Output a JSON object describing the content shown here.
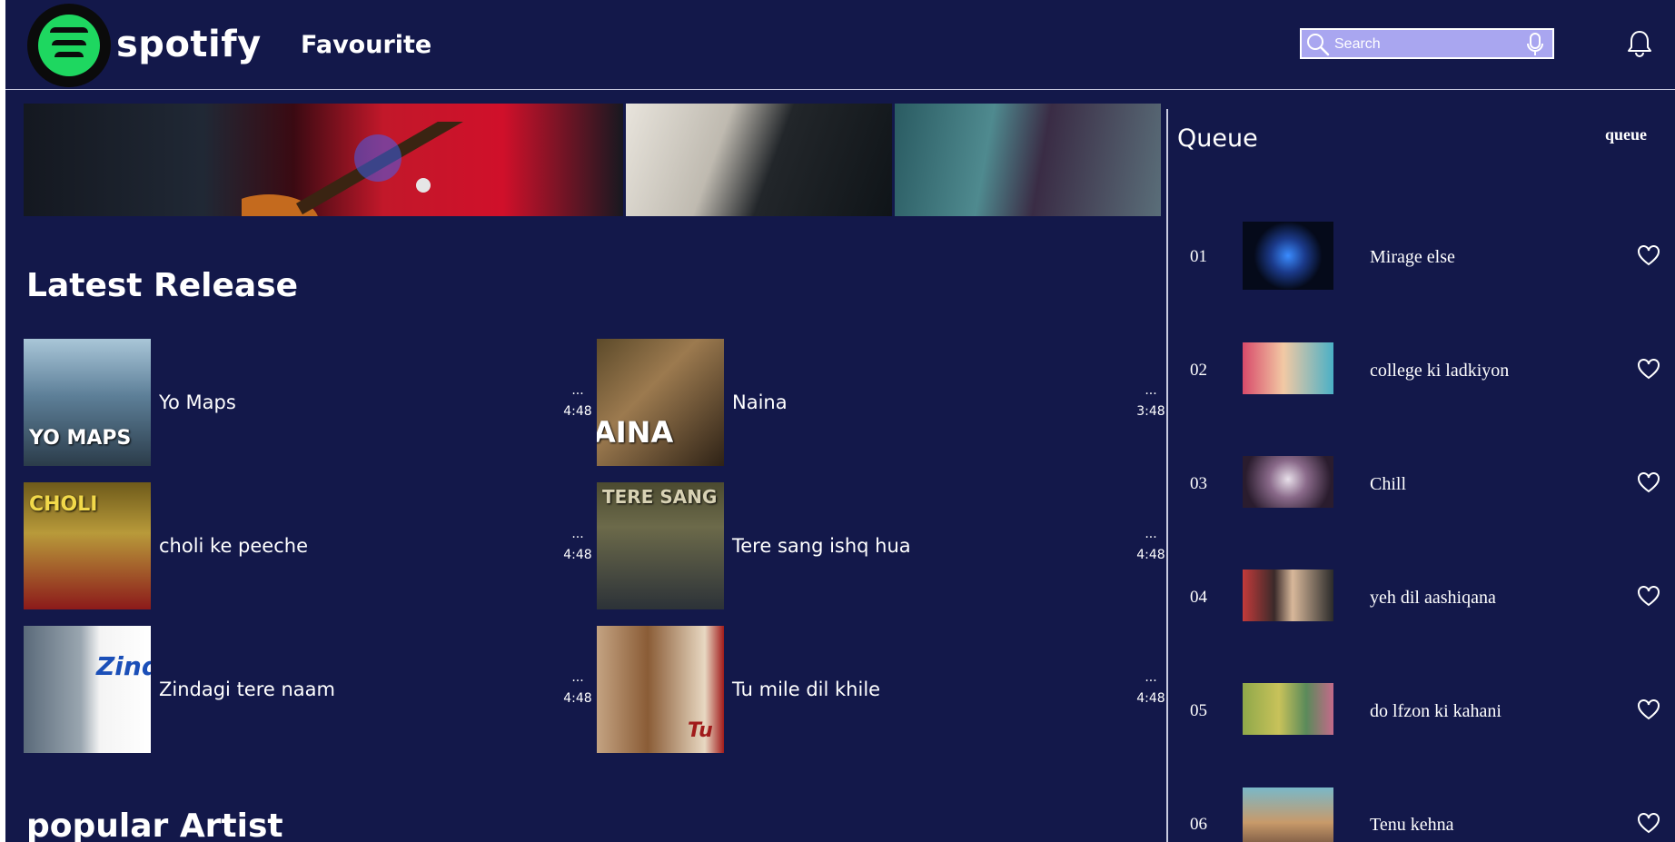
{
  "header": {
    "brand": "spotify",
    "nav_favourite": "Favourite",
    "search_placeholder": "Search"
  },
  "icons": {
    "logo": "spotify-logo",
    "search": "search-icon",
    "mic": "mic-icon",
    "bell": "bell-icon",
    "heart": "heart-icon"
  },
  "colors": {
    "background": "#13184a",
    "search_box": "#a9a6f0",
    "brand_green": "#1ed760"
  },
  "latest_release": {
    "title": "Latest Release",
    "songs": [
      {
        "title": "Yo Maps",
        "more": "...",
        "duration": "4:48",
        "cover_text": "YO MAPS"
      },
      {
        "title": "Naina",
        "more": "...",
        "duration": "3:48",
        "cover_text": "AINA"
      },
      {
        "title": "choli ke peeche",
        "more": "...",
        "duration": "4:48",
        "cover_text": "CHOLI"
      },
      {
        "title": "Tere sang ishq hua",
        "more": "...",
        "duration": "4:48",
        "cover_text": "TERE SANG"
      },
      {
        "title": "Zindagi tere naam",
        "more": "...",
        "duration": "4:48",
        "cover_text": "Zind"
      },
      {
        "title": "Tu mile dil khile",
        "more": "...",
        "duration": "4:48",
        "cover_text": "Tu"
      }
    ]
  },
  "popular_artist": {
    "title": "popular Artist"
  },
  "queue": {
    "title": "Queue",
    "link": "queue",
    "items": [
      {
        "number": "01",
        "title": "Mirage else"
      },
      {
        "number": "02",
        "title": "college ki ladkiyon"
      },
      {
        "number": "03",
        "title": "Chill"
      },
      {
        "number": "04",
        "title": "yeh dil aashiqana"
      },
      {
        "number": "05",
        "title": "do lfzon ki kahani"
      },
      {
        "number": "06",
        "title": "Tenu kehna"
      }
    ]
  }
}
